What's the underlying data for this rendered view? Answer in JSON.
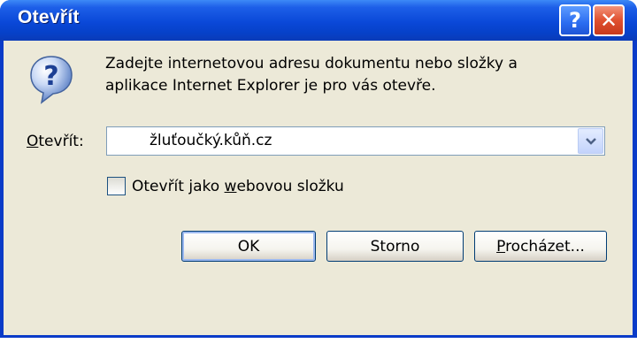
{
  "dialog": {
    "title": "Otevřít",
    "message_line1": "Zadejte internetovou adresu dokumentu nebo složky a",
    "message_line2": "aplikace Internet Explorer je pro vás otevře.",
    "icon": "question-icon"
  },
  "titlebar": {
    "help_glyph": "?",
    "close_glyph": "✕"
  },
  "address": {
    "label_accel": "O",
    "label_rest": "tevřít:",
    "value": "žluťoučký.kůň.cz"
  },
  "webfolder": {
    "label_pre": "Otevřít jako ",
    "label_accel": "w",
    "label_post": "ebovou složku",
    "checked": false
  },
  "buttons": {
    "ok": "OK",
    "cancel": "Storno",
    "browse_accel": "P",
    "browse_rest": "rocházet..."
  },
  "colors": {
    "titlebar": "#0a48d8",
    "client": "#ece9d8",
    "close": "#e0502f"
  }
}
